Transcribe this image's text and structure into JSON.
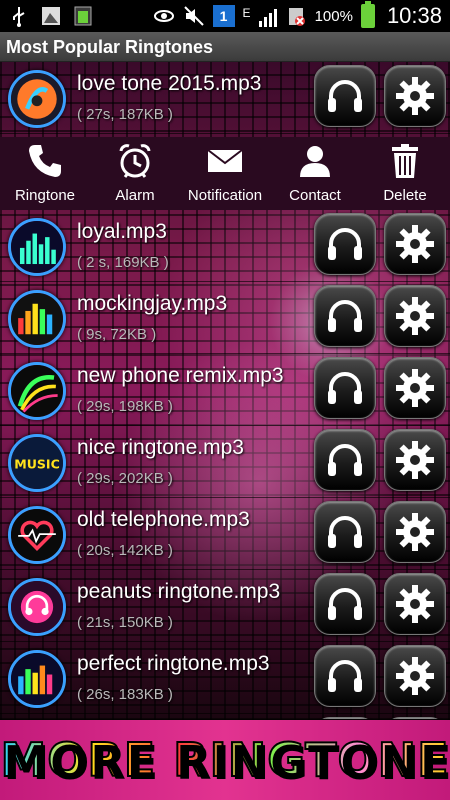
{
  "status_bar": {
    "battery_percent": "100%",
    "time": "10:38",
    "carrier_badge": "1",
    "network_letter": "E"
  },
  "title": "Most Popular Ringtones",
  "actions": [
    {
      "label": "Ringtone",
      "icon": "phone-icon"
    },
    {
      "label": "Alarm",
      "icon": "alarm-clock-icon"
    },
    {
      "label": "Notification",
      "icon": "envelope-icon"
    },
    {
      "label": "Contact",
      "icon": "person-icon"
    },
    {
      "label": "Delete",
      "icon": "trash-icon"
    }
  ],
  "ringtones": [
    {
      "name": "love tone 2015.mp3",
      "meta": "( 27s, 187KB )"
    },
    {
      "name": "loyal.mp3",
      "meta": "( 2 s, 169KB )"
    },
    {
      "name": "mockingjay.mp3",
      "meta": "( 9s, 72KB )"
    },
    {
      "name": "new phone remix.mp3",
      "meta": "( 29s, 198KB )"
    },
    {
      "name": "nice ringtone.mp3",
      "meta": "( 29s, 202KB )"
    },
    {
      "name": "old telephone.mp3",
      "meta": "( 20s, 142KB )"
    },
    {
      "name": "peanuts ringtone.mp3",
      "meta": "( 21s, 150KB )"
    },
    {
      "name": "perfect ringtone.mp3",
      "meta": "( 26s, 183KB )"
    }
  ],
  "thumb_text": {
    "music": "MUSIC"
  },
  "banner": "MORE RINGTONE",
  "colors": {
    "title_bar": "#4a4a4a",
    "thumb_ring": "#3aa0ff",
    "banner_bg": "#e23390"
  }
}
